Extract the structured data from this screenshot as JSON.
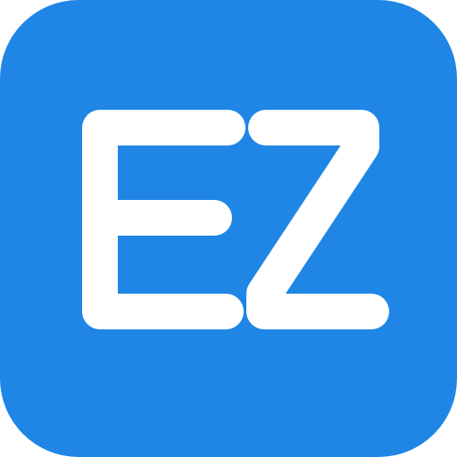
{
  "icon": {
    "monogram": "EZ",
    "background_color": "#1f86e5",
    "glyph_color": "#ffffff"
  }
}
